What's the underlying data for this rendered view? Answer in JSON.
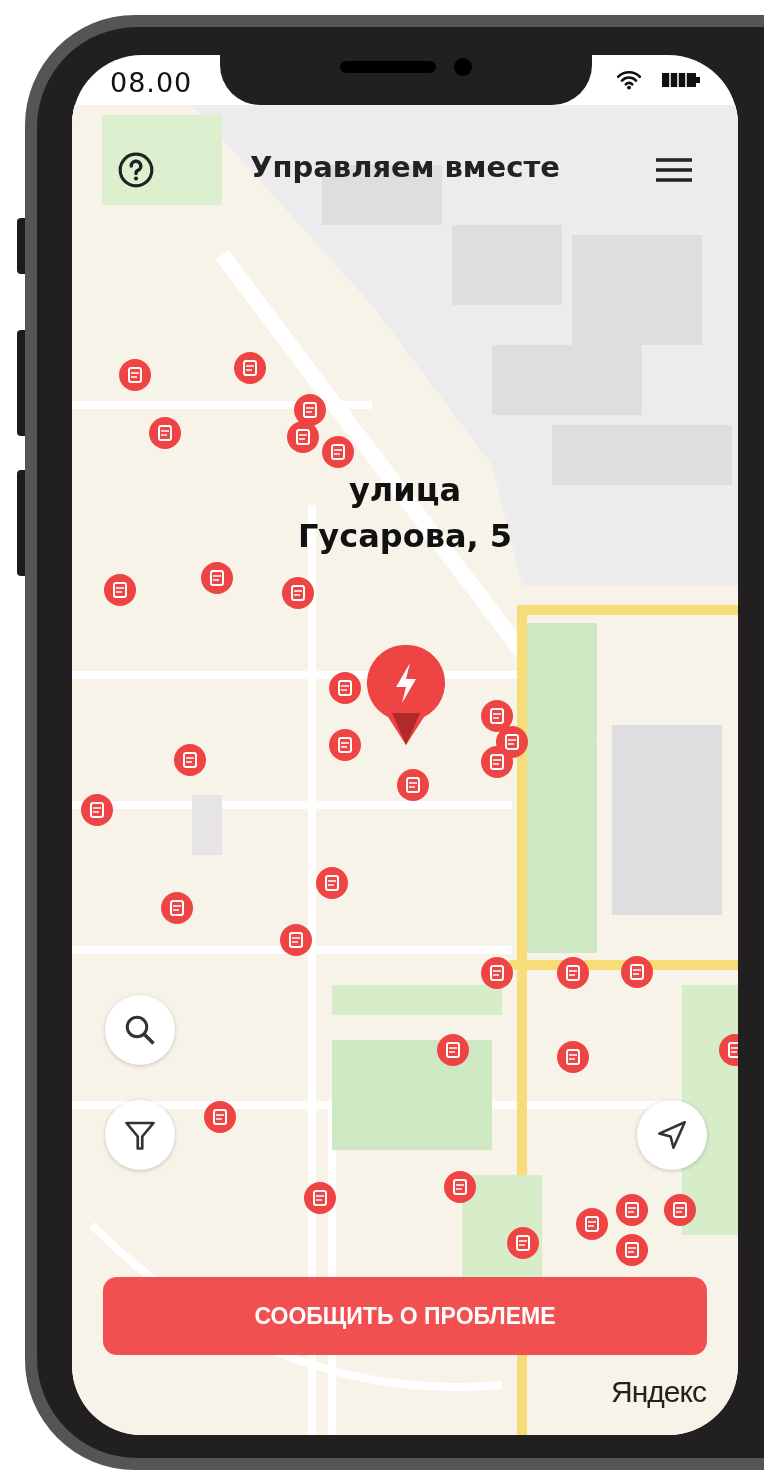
{
  "status_bar": {
    "time": "08.00"
  },
  "header": {
    "title": "Управляем вместе"
  },
  "map": {
    "address_label": "улица Гусарова, 5",
    "attribution": "Яндекс"
  },
  "report_button": {
    "label": "СООБЩИТЬ О ПРОБЛЕМЕ"
  }
}
